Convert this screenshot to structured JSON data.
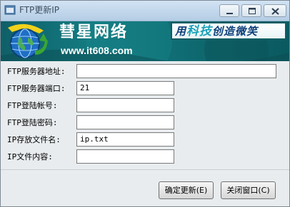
{
  "window": {
    "title": "FTP更新IP"
  },
  "banner": {
    "brand_name": "彗星网络",
    "brand_url": "www.it608.com",
    "slogan_parts": [
      "用",
      "科技",
      "创造微笑"
    ]
  },
  "form": {
    "fields": [
      {
        "label": "FTP服务器地址:",
        "value": ""
      },
      {
        "label": "FTP服务器端口:",
        "value": "21"
      },
      {
        "label": "FTP登陆帐号:",
        "value": ""
      },
      {
        "label": "FTP登陆密码:",
        "value": ""
      },
      {
        "label": "IP存放文件名:",
        "value": "ip.txt"
      },
      {
        "label": "IP文件内容:",
        "value": ""
      }
    ]
  },
  "buttons": {
    "ok_label": "确定更新(E)",
    "close_label": "关闭窗口(C)"
  },
  "icons": {
    "app": "app-icon",
    "minimize": "minimize-icon",
    "maximize": "maximize-icon",
    "close": "close-icon",
    "logo": "globe-arrow-logo-icon"
  }
}
